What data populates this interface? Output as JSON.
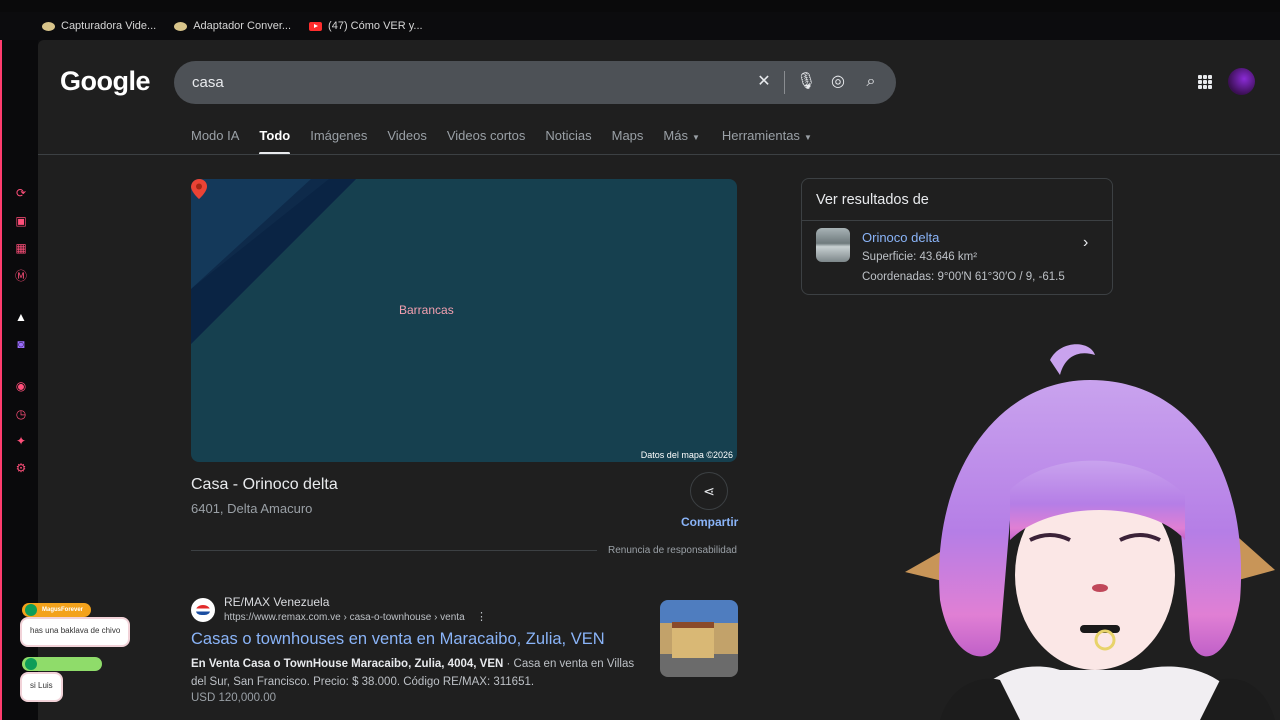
{
  "bookmarks": [
    {
      "label": "Capturadora Vide...",
      "icon": "bookmark-icon"
    },
    {
      "label": "Adaptador Conver...",
      "icon": "bookmark-icon"
    },
    {
      "label": "(47) Cómo VER y...",
      "icon": "youtube-icon"
    }
  ],
  "google": {
    "logo": "Google",
    "search_value": "casa",
    "tabs": [
      "Modo IA",
      "Todo",
      "Imágenes",
      "Videos",
      "Videos cortos",
      "Noticias",
      "Maps",
      "Más",
      "Herramientas"
    ],
    "active_tab": "Todo"
  },
  "map": {
    "label": "Barrancas",
    "attribution": "Datos del mapa ©2026"
  },
  "place": {
    "title": "Casa - Orinoco delta",
    "subtitle": "6401, Delta Amacuro",
    "share_label": "Compartir",
    "disclaimer": "Renuncia de responsabilidad"
  },
  "result": {
    "site": "RE/MAX Venezuela",
    "url": "https://www.remax.com.ve › casa-o-townhouse › venta",
    "title": "Casas o townhouses en venta en Maracaibo, Zulia, VEN",
    "snippet_bold": "En Venta Casa o TownHouse Maracaibo, Zulia, 4004, VEN",
    "snippet_rest": " · Casa en venta en Villas del Sur, San Francisco. Precio: $ 38.000. Código RE/MAX: 311651.",
    "price": "USD 120,000.00"
  },
  "kcard": {
    "heading": "Ver resultados de",
    "name": "Orinoco delta",
    "line1": "Superficie: 43.646 km²",
    "line2": "Coordenadas: 9°00′N 61°30′O / 9, -61.5"
  },
  "chat": [
    {
      "user": "MagusForever",
      "message": "has una baklava de chivo",
      "color": "#f3a21b"
    },
    {
      "user": "",
      "message": "si Luis",
      "color": "#8fdc6a"
    }
  ],
  "colors": {
    "page_bg": "#1f1f1f",
    "link": "#8ab4f8",
    "rail_accent": "#ff3c6e"
  }
}
